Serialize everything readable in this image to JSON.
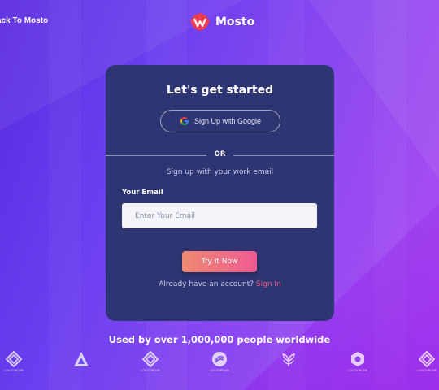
{
  "header": {
    "back_link": "ack To Mosto",
    "logo_text": "Mosto"
  },
  "card": {
    "title": "Let's get started",
    "google_button": "Sign Up with Google",
    "or": "OR",
    "subtitle": "Sign up with your work email",
    "email_label": "Your Email",
    "email_placeholder": "Enter Your Email",
    "email_value": "",
    "submit": "Try It Now",
    "already_text": "Already have an account?",
    "signin_link": "Sign In"
  },
  "footer": {
    "used_by": "Used by over 1,000,000 people worldwide",
    "brands": [
      {
        "icon": "diamond-knot-icon",
        "label": "LOGOIPSUM"
      },
      {
        "icon": "triangle-a-icon",
        "label": ""
      },
      {
        "icon": "diamond-knot-icon",
        "label": "LOGOIPSUM"
      },
      {
        "icon": "circle-swirl-icon",
        "label": "LOGOIPSUM"
      },
      {
        "icon": "leaf-icon",
        "label": ""
      },
      {
        "icon": "hexagon-ring-icon",
        "label": "LOGOIPSUM"
      },
      {
        "icon": "diamond-knot-icon",
        "label": "LOGOIPSUM"
      }
    ]
  },
  "colors": {
    "card_bg": "#2e3573",
    "accent_link": "#f0577a",
    "button_start": "#ef8a72",
    "button_end": "#ee5a92"
  }
}
